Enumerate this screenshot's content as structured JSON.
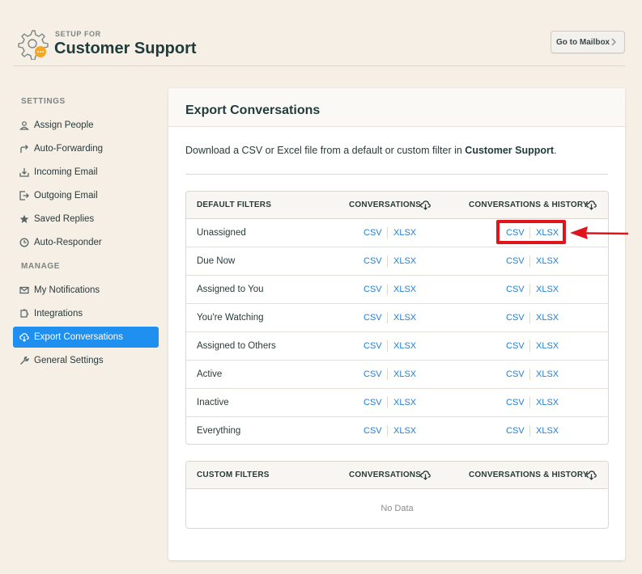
{
  "header": {
    "setup_for": "SETUP FOR",
    "title": "Customer Support",
    "goto_label": "Go to Mailbox"
  },
  "sidebar": {
    "sections": [
      {
        "label": "SETTINGS",
        "items": [
          {
            "label": "Assign People",
            "icon": "person-icon"
          },
          {
            "label": "Auto-Forwarding",
            "icon": "forward-arrow-icon"
          },
          {
            "label": "Incoming Email",
            "icon": "inbox-download-icon"
          },
          {
            "label": "Outgoing Email",
            "icon": "outbox-icon"
          },
          {
            "label": "Saved Replies",
            "icon": "star-icon"
          },
          {
            "label": "Auto-Responder",
            "icon": "clock-icon"
          }
        ]
      },
      {
        "label": "MANAGE",
        "items": [
          {
            "label": "My Notifications",
            "icon": "envelope-icon"
          },
          {
            "label": "Integrations",
            "icon": "puzzle-icon"
          },
          {
            "label": "Export Conversations",
            "icon": "cloud-download-icon",
            "active": true
          },
          {
            "label": "General Settings",
            "icon": "wrench-icon"
          }
        ]
      }
    ]
  },
  "panel": {
    "title": "Export Conversations",
    "intro_prefix": "Download a CSV or Excel file from a default or custom filter in ",
    "intro_bold": "Customer Support",
    "intro_suffix": "."
  },
  "default_table": {
    "headers": [
      "DEFAULT FILTERS",
      "CONVERSATIONS",
      "CONVERSATIONS & HISTORY"
    ],
    "csv_label": "CSV",
    "xlsx_label": "XLSX",
    "rows": [
      "Unassigned",
      "Due Now",
      "Assigned to You",
      "You're Watching",
      "Assigned to Others",
      "Active",
      "Inactive",
      "Everything"
    ]
  },
  "custom_table": {
    "headers": [
      "CUSTOM FILTERS",
      "CONVERSATIONS",
      "CONVERSATIONS & HISTORY"
    ],
    "empty_text": "No Data"
  },
  "colors": {
    "accent": "#1f8ff0",
    "link": "#1f7fd6",
    "highlight": "#e0141b",
    "background": "#f5efe6"
  }
}
